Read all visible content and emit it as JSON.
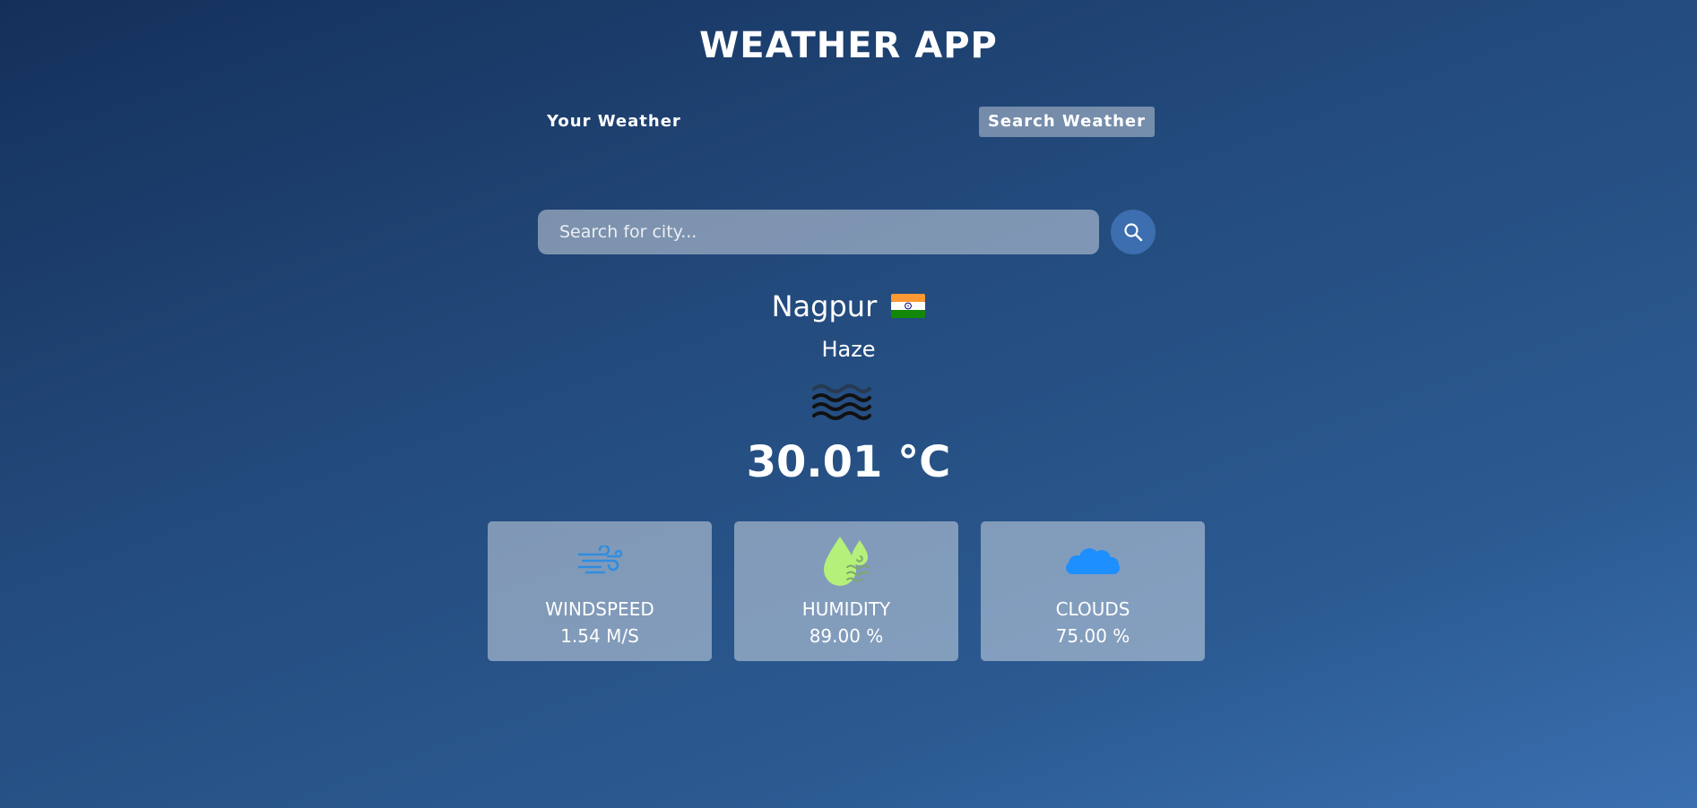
{
  "app": {
    "title": "WEATHER APP"
  },
  "tabs": {
    "your_weather": "Your Weather",
    "search_weather": "Search Weather"
  },
  "search": {
    "placeholder": "Search for city...",
    "value": ""
  },
  "weather": {
    "city": "Nagpur",
    "country_flag": "India flag",
    "description": "Haze",
    "icon": "haze-icon",
    "temperature": "30.01 °C"
  },
  "stats": {
    "windspeed": {
      "label": "WINDSPEED",
      "value": "1.54 M/S",
      "icon": "wind-icon"
    },
    "humidity": {
      "label": "HUMIDITY",
      "value": "89.00 %",
      "icon": "humidity-icon"
    },
    "clouds": {
      "label": "CLOUDS",
      "value": "75.00 %",
      "icon": "cloud-icon"
    }
  },
  "colors": {
    "background_top": "#14305a",
    "background_bottom": "#3a6fb0",
    "search_button": "#3c6eb0",
    "wind_icon": "#2f8de0",
    "humidity_icon": "#b5f07a",
    "cloud_icon": "#1e8fff"
  }
}
